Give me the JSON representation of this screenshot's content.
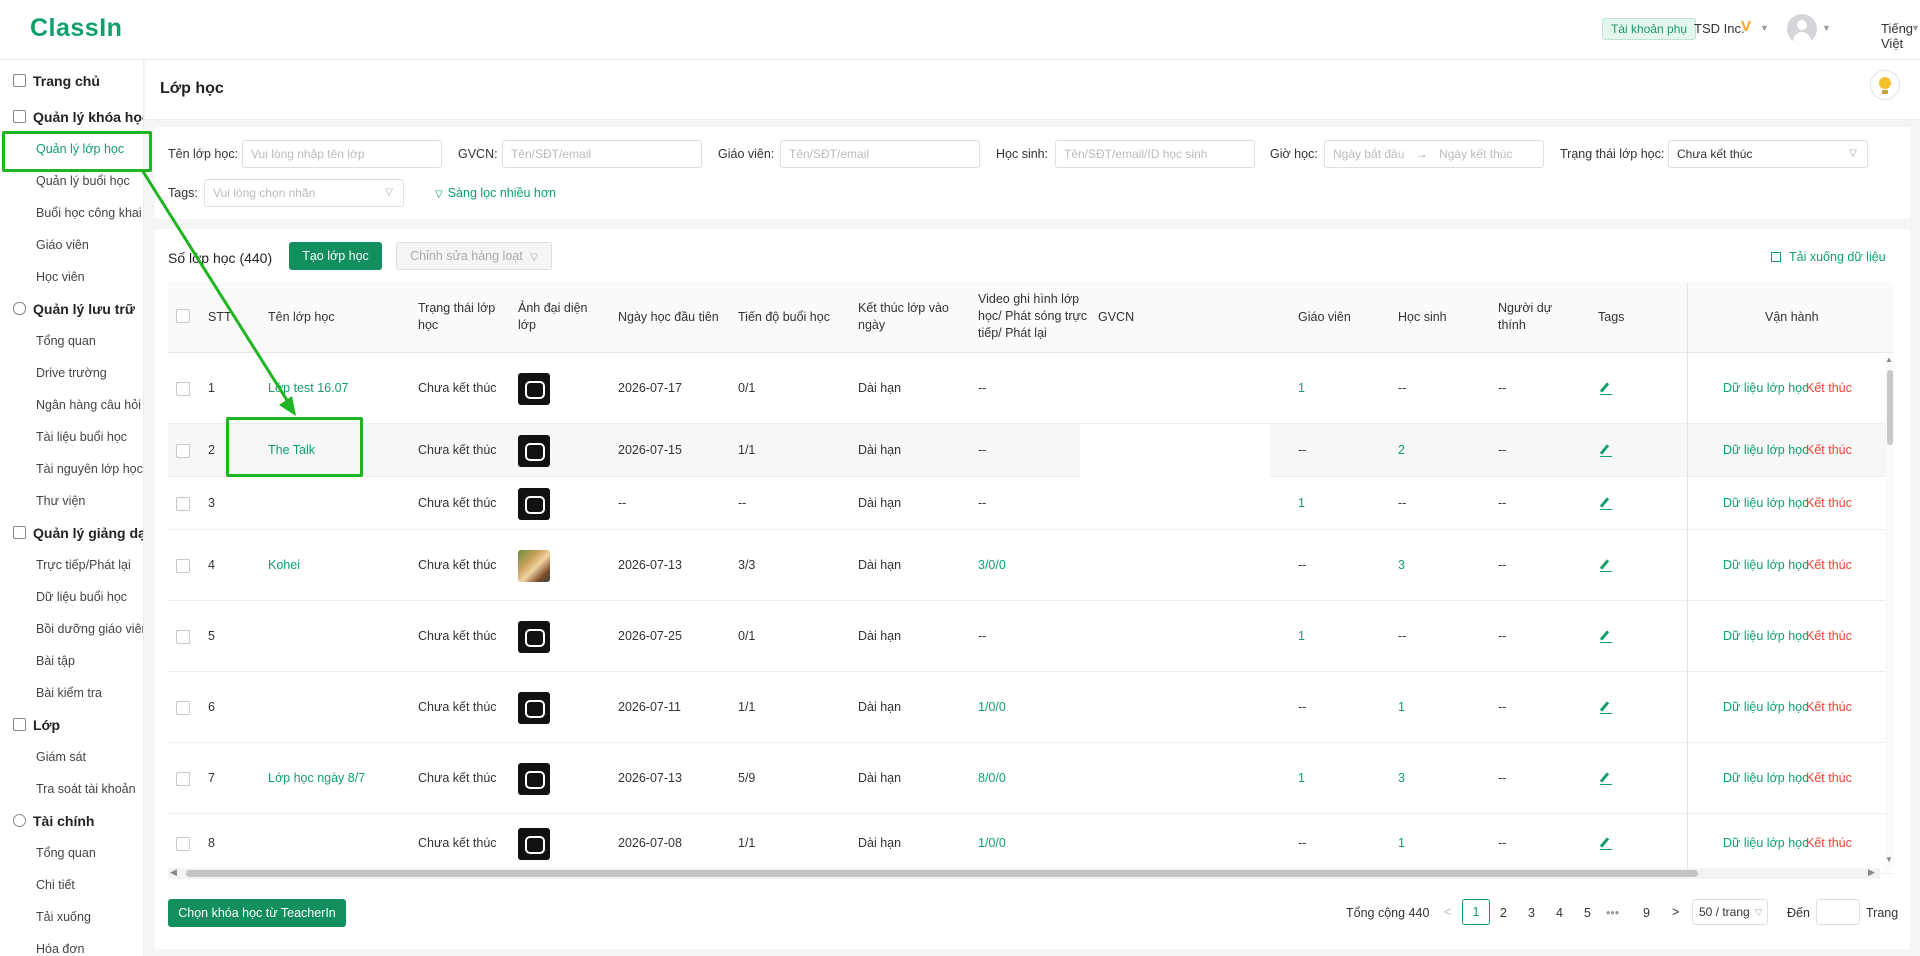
{
  "header": {
    "logo": "ClassIn",
    "sub_account": "Tài khoản phụ",
    "org_name": "TSD Inc.",
    "vip_badge": "V",
    "language": "Tiếng Việt"
  },
  "sidebar": {
    "sections": [
      {
        "label": "Trang chủ"
      },
      {
        "label": "Quản lý khóa học"
      },
      {
        "label": "Quản lý lưu trữ"
      },
      {
        "label": "Quản lý giảng dạy"
      },
      {
        "label": "Lớp"
      },
      {
        "label": "Tài chính"
      }
    ],
    "items": [
      "Quản lý lớp học",
      "Quản lý buổi học",
      "Buổi học công khai",
      "Giáo viên",
      "Học viên",
      "Tổng quan",
      "Drive trường",
      "Ngân hàng câu hỏi",
      "Tài liệu buổi học",
      "Tài nguyên lớp học",
      "Thư viện",
      "Trực tiếp/Phát lại",
      "Dữ liệu buổi học",
      "Bồi dưỡng giáo viên",
      "Bài tập",
      "Bài kiểm tra",
      "Giám sát",
      "Tra soát tài khoản",
      "Tổng quan",
      "Chi tiết",
      "Tải xuống",
      "Hóa đơn"
    ]
  },
  "page": {
    "title": "Lớp học"
  },
  "filters": {
    "class_name_label": "Tên lớp học:",
    "class_name_placeholder": "Vui lòng nhập tên lớp",
    "gvcn_label": "GVCN:",
    "gvcn_placeholder": "Tên/SĐT/email",
    "teacher_label": "Giáo viên:",
    "teacher_placeholder": "Tên/SĐT/email",
    "student_label": "Học sinh:",
    "student_placeholder": "Tên/SĐT/email/ID học sinh",
    "time_label": "Giờ học:",
    "start_placeholder": "Ngày bắt đầu",
    "end_placeholder": "Ngày kết thúc",
    "status_label": "Trạng thái lớp học:",
    "status_value": "Chưa kết thúc",
    "tags_label": "Tags:",
    "tags_placeholder": "Vui lòng chọn nhãn",
    "more_filters": "Sàng lọc nhiều hơn"
  },
  "toolbar": {
    "count_label": "Số lớp học (440)",
    "create_button": "Tạo lớp học",
    "batch_edit": "Chỉnh sửa hàng loạt",
    "download": "Tải xuống dữ liệu"
  },
  "table": {
    "headers": {
      "stt": "STT",
      "name": "Tên lớp học",
      "status": "Trạng thái lớp học",
      "avatar": "Ảnh đại diện lớp",
      "first_day": "Ngày học đầu tiên",
      "progress": "Tiến độ buổi học",
      "end": "Kết thúc lớp vào ngày",
      "video": "Video ghi hình lớp học/ Phát sóng trực tiếp/ Phát lại",
      "gvcn": "GVCN",
      "teacher": "Giáo viên",
      "student": "Học sinh",
      "audit": "Người dự thính",
      "tags": "Tags",
      "ops": "Vận hành"
    },
    "rows": [
      {
        "stt": "1",
        "name": "Lớp test 16.07",
        "status": "Chưa kết thúc",
        "first_day": "2026-07-17",
        "progress": "0/1",
        "end": "Dài hạn",
        "video": "--",
        "teacher": "1",
        "student": "--",
        "audit": "--",
        "op1": "Dữ liệu lớp học",
        "op2": "Kết thúc"
      },
      {
        "stt": "2",
        "name": "The Talk",
        "status": "Chưa kết thúc",
        "first_day": "2026-07-15",
        "progress": "1/1",
        "end": "Dài hạn",
        "video": "--",
        "teacher": "--",
        "student": "2",
        "audit": "--",
        "op1": "Dữ liệu lớp học",
        "op2": "Kết thúc"
      },
      {
        "stt": "3",
        "name": "",
        "status": "Chưa kết thúc",
        "first_day": "--",
        "progress": "--",
        "end": "Dài hạn",
        "video": "--",
        "teacher": "1",
        "student": "--",
        "audit": "--",
        "op1": "Dữ liệu lớp học",
        "op2": "Kết thúc"
      },
      {
        "stt": "4",
        "name": "Kohei",
        "status": "Chưa kết thúc",
        "first_day": "2026-07-13",
        "progress": "3/3",
        "end": "Dài hạn",
        "video": "3/0/0",
        "teacher": "--",
        "student": "3",
        "audit": "--",
        "op1": "Dữ liệu lớp học",
        "op2": "Kết thúc"
      },
      {
        "stt": "5",
        "name": "",
        "status": "Chưa kết thúc",
        "first_day": "2026-07-25",
        "progress": "0/1",
        "end": "Dài hạn",
        "video": "--",
        "teacher": "1",
        "student": "--",
        "audit": "--",
        "op1": "Dữ liệu lớp học",
        "op2": "Kết thúc"
      },
      {
        "stt": "6",
        "name": "",
        "status": "Chưa kết thúc",
        "first_day": "2026-07-11",
        "progress": "1/1",
        "end": "Dài hạn",
        "video": "1/0/0",
        "teacher": "--",
        "student": "1",
        "audit": "--",
        "op1": "Dữ liệu lớp học",
        "op2": "Kết thúc"
      },
      {
        "stt": "7",
        "name": "Lớp học ngày 8/7",
        "status": "Chưa kết thúc",
        "first_day": "2026-07-13",
        "progress": "5/9",
        "end": "Dài hạn",
        "video": "8/0/0",
        "teacher": "1",
        "student": "3",
        "audit": "--",
        "op1": "Dữ liệu lớp học",
        "op2": "Kết thúc"
      },
      {
        "stt": "8",
        "name": "",
        "status": "Chưa kết thúc",
        "first_day": "2026-07-08",
        "progress": "1/1",
        "end": "Dài hạn",
        "video": "1/0/0",
        "teacher": "--",
        "student": "1",
        "audit": "--",
        "op1": "Dữ liệu lớp học",
        "op2": "Kết thúc"
      }
    ]
  },
  "footer": {
    "select_button": "Chọn khóa học từ TeacherIn",
    "total": "Tổng cộng 440",
    "pages": [
      "1",
      "2",
      "3",
      "4",
      "5",
      "•••",
      "9"
    ],
    "page_size": "50 / trang",
    "goto_label": "Đến",
    "page_unit": "Trang"
  },
  "colors": {
    "brand": "#11a06a",
    "danger": "#f04134",
    "annotation": "#1fb520"
  }
}
